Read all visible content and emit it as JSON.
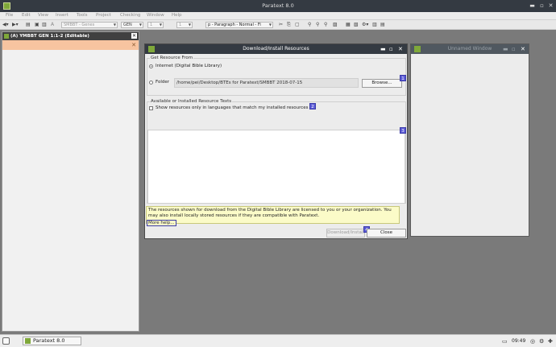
{
  "app": {
    "title": "Paratext 8.0"
  },
  "menu": [
    "File",
    "Edit",
    "View",
    "Insert",
    "Tools",
    "Project",
    "Checking",
    "Window",
    "Help"
  ],
  "toolbar": {
    "font_size": "A",
    "project_combo": "SMBBT - Genes",
    "book_combo": "GEN",
    "chapter_combo": "1",
    "verse_combo": "1",
    "style_combo": "p - Paragraph - Normal - Fi"
  },
  "left_panel": {
    "title": "(A) YMBBT GEN 1:1-2 (Editable)"
  },
  "dialog": {
    "title": "Download/Install Resources",
    "get_resource_group": "Get Resource From",
    "radio_internet": "Internet (Digital Bible Library)",
    "radio_folder": "Folder",
    "folder_path": "/home/pei/Desktop/BTEs for Paratext/SMBBT 2018-07-15",
    "browse_button": "Browse...",
    "available_group": "Available or Installed Resource Texts",
    "filter_checkbox": "Show resources only in languages that match my installed resources",
    "info_text": "The resources shown for download from the Digital Bible Library are licensed to you or your organization. You may also install locally stored resources if they are compatible with Paratext.",
    "more_help": "More help...",
    "download_button": "Download/Install",
    "close_button": "Close",
    "badges": [
      "1",
      "2",
      "3",
      "4"
    ]
  },
  "unnamed_window": {
    "title": "Unnamed Window"
  },
  "taskbar": {
    "app_button": "Paratext 8.0",
    "time": "09:49"
  },
  "colors": {
    "titlebar": "#343a42",
    "accent_logo": "#7fa83a",
    "badge": "#5b5bd6",
    "info_bg": "#fbfbc8",
    "highlight_bar": "#f7c4a0"
  }
}
